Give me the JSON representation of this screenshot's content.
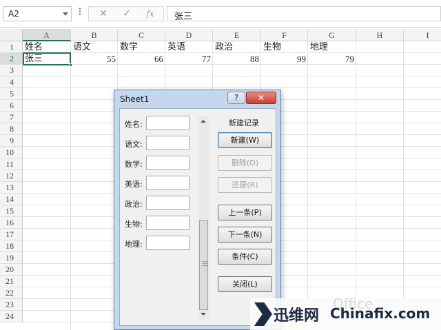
{
  "formula_bar": {
    "name_box": "A2",
    "cancel_icon": "✕",
    "enter_icon": "✓",
    "fx_label": "fx",
    "value": "张三"
  },
  "columns": [
    "A",
    "B",
    "C",
    "D",
    "E",
    "F",
    "G",
    "H",
    "I"
  ],
  "rows": [
    "1",
    "2",
    "3",
    "4",
    "5",
    "6",
    "7",
    "8",
    "9",
    "10",
    "11",
    "12",
    "13",
    "14",
    "15",
    "16",
    "17",
    "18",
    "19",
    "20",
    "21",
    "22",
    "23",
    "24"
  ],
  "sheet": {
    "headers": [
      "姓名",
      "语文",
      "数学",
      "英语",
      "政治",
      "生物",
      "地理"
    ],
    "row2": {
      "name": "张三",
      "scores": [
        "55",
        "66",
        "77",
        "88",
        "99",
        "79"
      ]
    }
  },
  "dialog": {
    "title": "Sheet1",
    "help_label": "?",
    "close_label": "✕",
    "fields": [
      "姓名:",
      "语文:",
      "数学:",
      "英语:",
      "政治:",
      "生物:",
      "地理:"
    ],
    "record_status": "新建记录",
    "buttons": {
      "new": "新建(W)",
      "delete": "删除(D)",
      "restore": "还原(R)",
      "prev": "上一条(P)",
      "next": "下一条(N)",
      "criteria": "条件(C)",
      "close": "关闭(L)"
    }
  },
  "watermark": {
    "cn": "迅维网",
    "en": "Chinafix.com",
    "ghost": "Office"
  }
}
